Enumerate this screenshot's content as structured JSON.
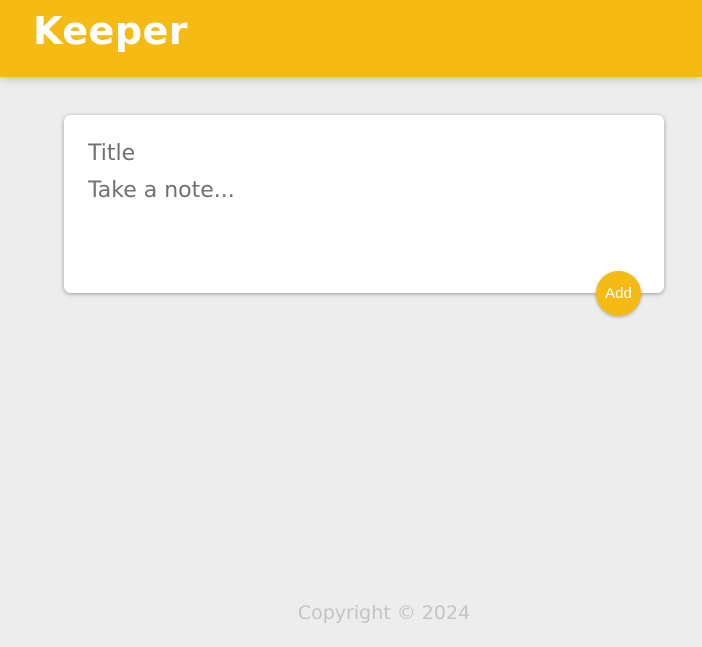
{
  "header": {
    "brand": "Keeper"
  },
  "composer": {
    "title_placeholder": "Title",
    "title_value": "",
    "note_placeholder": "Take a note...",
    "note_value": "",
    "add_label": "Add"
  },
  "footer": {
    "copyright": "Copyright © 2024"
  },
  "colors": {
    "accent": "#f5ba13",
    "background": "#ededed",
    "card": "#ffffff",
    "footer_text": "#c3c3c3"
  }
}
